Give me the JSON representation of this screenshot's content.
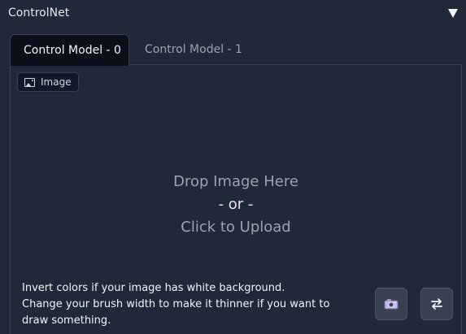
{
  "header": {
    "title": "ControlNet"
  },
  "tabs": [
    {
      "label": "Control Model - 0",
      "active": true
    },
    {
      "label": "Control Model - 1",
      "active": false
    }
  ],
  "image_input": {
    "label": "Image",
    "drop_line1": "Drop Image Here",
    "drop_line2": "- or -",
    "drop_line3": "Click to Upload"
  },
  "hint": {
    "line1": "Invert colors if your image has white background.",
    "line2": "Change your brush width to make it thinner if you want to draw something."
  },
  "icons": {
    "collapse": "triangle-down-icon",
    "image": "image-icon",
    "camera": "camera-icon",
    "swap": "swap-arrows-icon"
  }
}
